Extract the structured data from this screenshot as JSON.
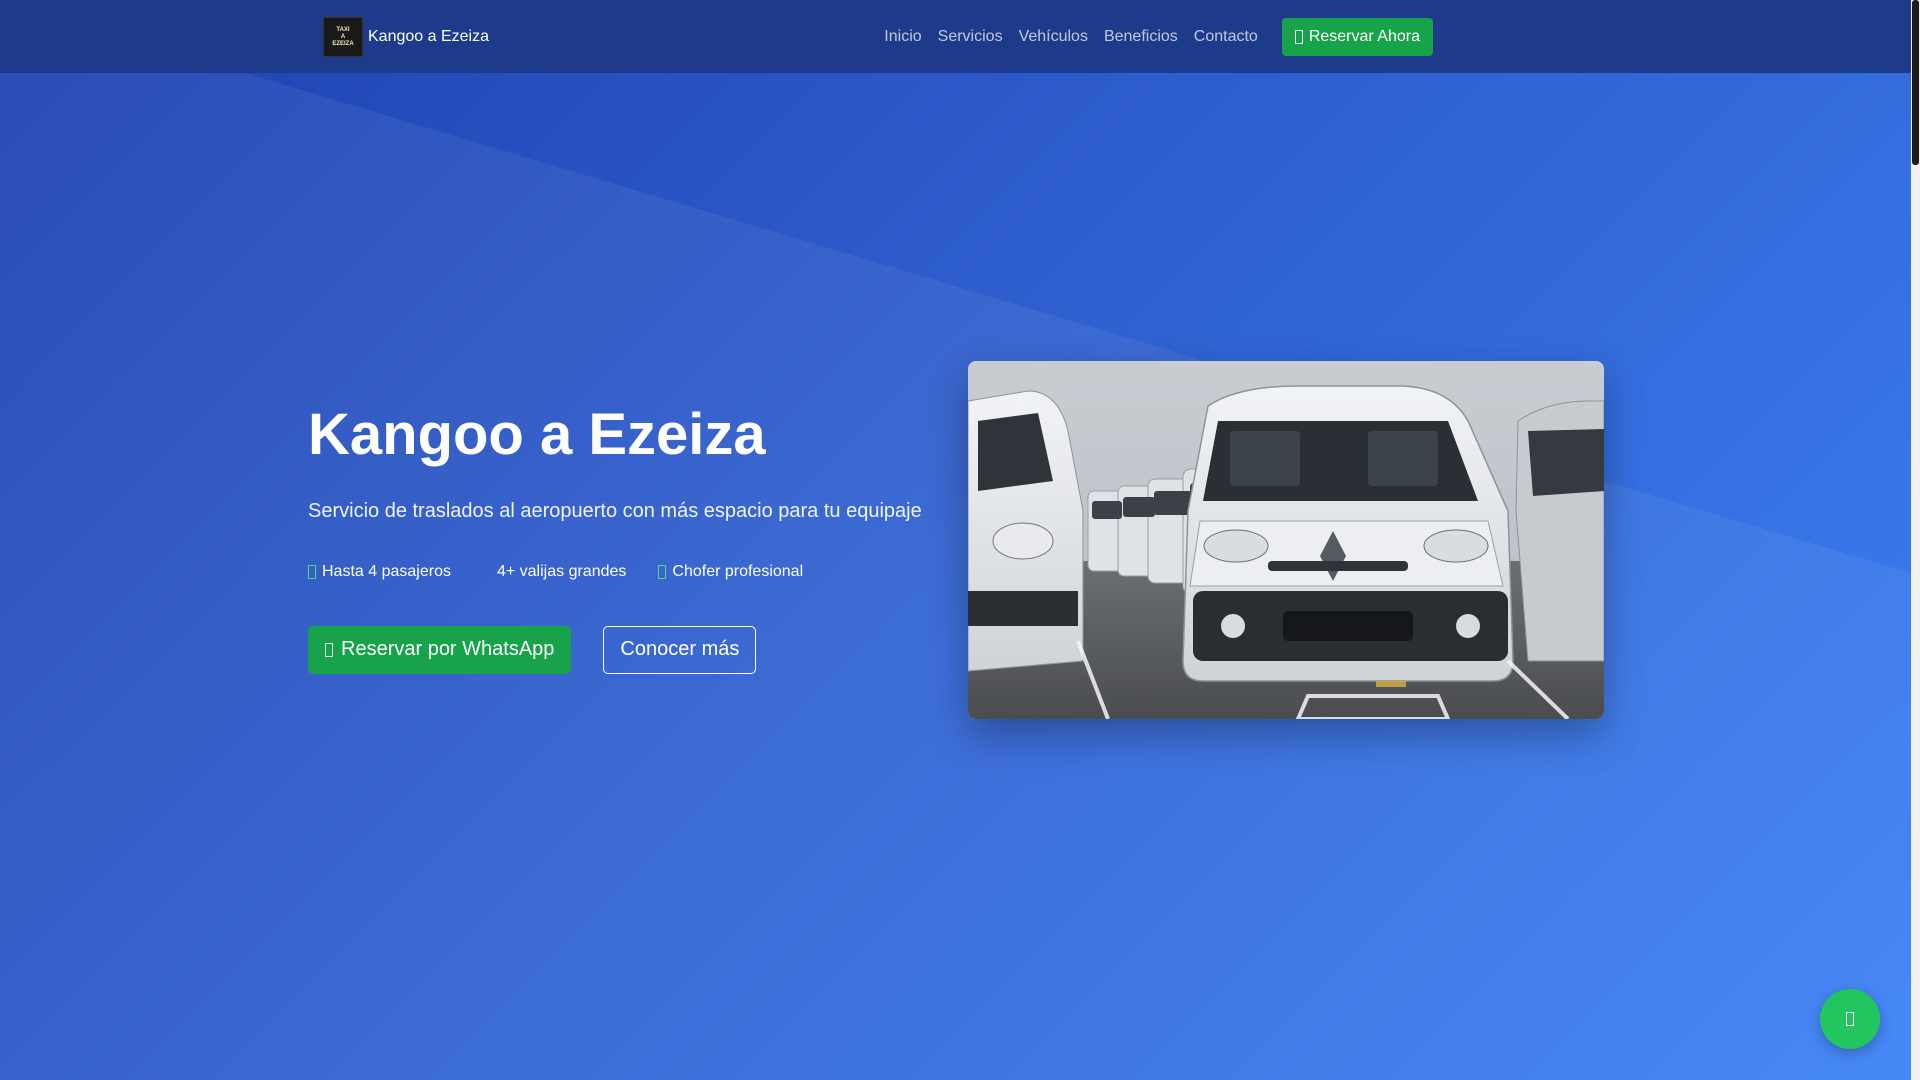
{
  "navbar": {
    "brand": {
      "name": "Kangoo a Ezeiza",
      "logo_lines": [
        "TAXI",
        "A",
        "EZEIZA"
      ]
    },
    "links": [
      "Inicio",
      "Servicios",
      "Vehículos",
      "Beneficios",
      "Contacto"
    ],
    "cta_label": "Reservar Ahora",
    "cta_icon": "whatsapp-icon"
  },
  "hero": {
    "title": "Kangoo a Ezeiza",
    "subtitle": "Servicio de traslados al aeropuerto con más espacio para tu equipaje",
    "features": [
      {
        "label": "Hasta 4 pasajeros",
        "icon": "users-icon"
      },
      {
        "label": "4+ valijas grandes",
        "icon": "suitcase-icon"
      },
      {
        "label": "Chofer profesional",
        "icon": "id-card-icon"
      }
    ],
    "primary_button": "Reservar por WhatsApp",
    "secondary_button": "Conocer más",
    "image_subject": "fleet of white Renault Kangoo vans in a parking lot"
  },
  "floating_button": {
    "icon": "whatsapp-icon"
  },
  "colors": {
    "navbar": "#1e3a8a",
    "hero_start": "#1e40af",
    "hero_end": "#3b82f6",
    "accent_green": "#16a34a",
    "float_green": "#22c55e"
  }
}
